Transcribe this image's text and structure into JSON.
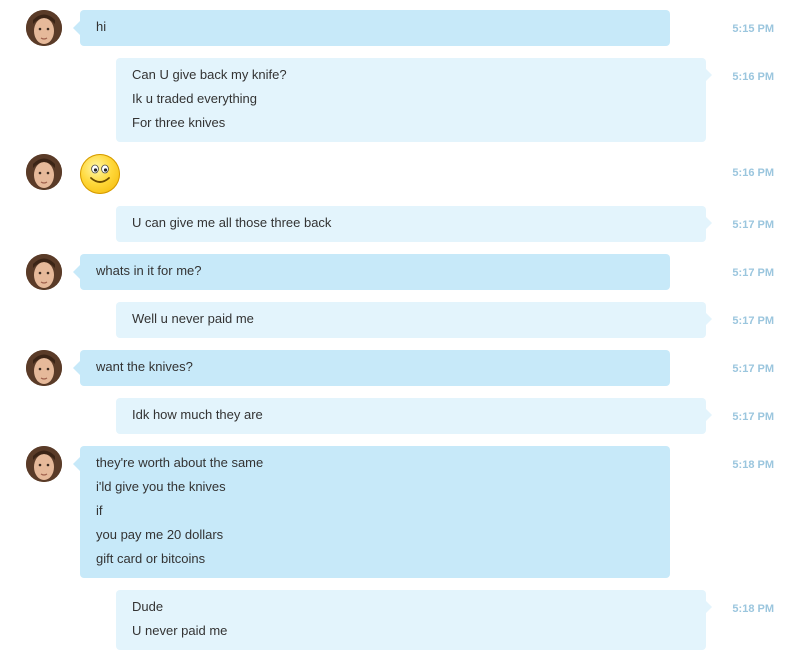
{
  "messages": [
    {
      "from": "them",
      "lines": [
        "hi"
      ],
      "time": "5:15 PM"
    },
    {
      "from": "me",
      "lines": [
        "Can U give back my knife?",
        "Ik u traded everything",
        "For three knives"
      ],
      "time": "5:16 PM"
    },
    {
      "from": "them",
      "emoticon": "smile-icon",
      "time": "5:16 PM"
    },
    {
      "from": "me",
      "lines": [
        "U can give me all those three back"
      ],
      "time": "5:17 PM"
    },
    {
      "from": "them",
      "lines": [
        "whats in it for me?"
      ],
      "time": "5:17 PM"
    },
    {
      "from": "me",
      "lines": [
        "Well u never paid me"
      ],
      "time": "5:17 PM"
    },
    {
      "from": "them",
      "lines": [
        "want the knives?"
      ],
      "time": "5:17 PM"
    },
    {
      "from": "me",
      "lines": [
        "Idk how much they are"
      ],
      "time": "5:17 PM"
    },
    {
      "from": "them",
      "lines": [
        "they're worth about the same",
        "i'ld give you the knives",
        "if",
        "you pay me 20 dollars",
        "gift card or bitcoins"
      ],
      "time": "5:18 PM"
    },
    {
      "from": "me",
      "lines": [
        "Dude",
        "U never paid me"
      ],
      "time": "5:18 PM"
    }
  ],
  "colors": {
    "incoming_bubble": "#c7e9f9",
    "outgoing_bubble": "#e3f4fc",
    "timestamp": "#9bc6de",
    "text": "#333333"
  }
}
